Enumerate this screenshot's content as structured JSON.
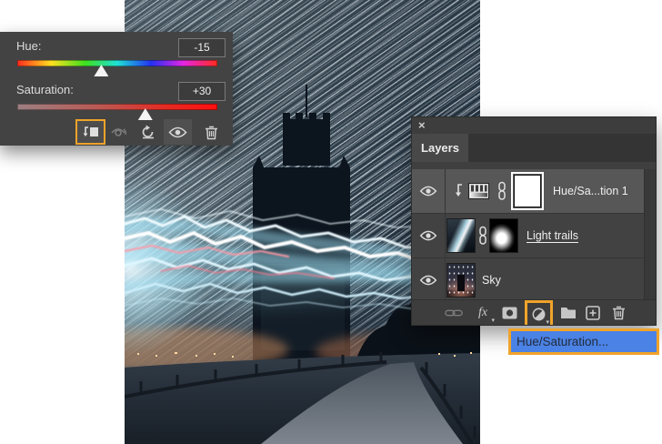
{
  "properties_panel": {
    "hue": {
      "label": "Hue:",
      "value": "-15",
      "thumb_pct": 42
    },
    "saturation": {
      "label": "Saturation:",
      "value": "+30",
      "thumb_pct": 64
    }
  },
  "layers_panel": {
    "close_label": "×",
    "tab_label": "Layers",
    "layers": [
      {
        "name": "Hue/Sa...tion 1"
      },
      {
        "name": "Light trails"
      },
      {
        "name": "Sky"
      }
    ],
    "toolbar": {
      "fx_label": "fx"
    }
  },
  "adjustment_menu": {
    "item_label": "Hue/Saturation..."
  },
  "colors": {
    "highlight_orange": "#f0a32a",
    "selection_blue": "#4a82e6"
  }
}
